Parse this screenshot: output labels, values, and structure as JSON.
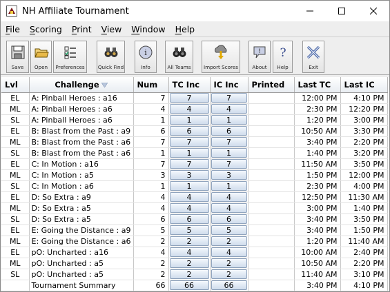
{
  "window": {
    "title": "NH Affiliate Tournament",
    "controls": [
      "minimize-icon",
      "maximize-icon",
      "close-icon"
    ]
  },
  "menu": [
    {
      "label_u": "F",
      "label_rest": "ile"
    },
    {
      "label_u": "S",
      "label_rest": "coring"
    },
    {
      "label_u": "P",
      "label_rest": "rint"
    },
    {
      "label_u": "V",
      "label_rest": "iew"
    },
    {
      "label_u": "W",
      "label_rest": "indow"
    },
    {
      "label_u": "H",
      "label_rest": "elp"
    }
  ],
  "toolbar": {
    "save": "Save",
    "open": "Open",
    "preferences": "Preferences",
    "quick_find": "Quick Find",
    "info": "Info",
    "all_teams": "All Teams",
    "import_scores": "Import Scores",
    "about": "About",
    "help": "Help",
    "exit": "Exit"
  },
  "table": {
    "columns": [
      "Lvl",
      "Challenge",
      "Num",
      "TC Inc",
      "IC Inc",
      "Printed",
      "Last TC",
      "Last IC"
    ],
    "sorted_column": "Challenge",
    "rows": [
      {
        "lvl": "EL",
        "challenge": "A: Pinball Heroes : a16",
        "num": "7",
        "tc_inc": "7",
        "ic_inc": "7",
        "printed": "",
        "last_tc": "12:00 PM",
        "last_ic": "4:10 PM"
      },
      {
        "lvl": "ML",
        "challenge": "A: Pinball Heroes : a6",
        "num": "4",
        "tc_inc": "4",
        "ic_inc": "4",
        "printed": "",
        "last_tc": "2:30 PM",
        "last_ic": "12:20 PM"
      },
      {
        "lvl": "SL",
        "challenge": "A: Pinball Heroes : a6",
        "num": "1",
        "tc_inc": "1",
        "ic_inc": "1",
        "printed": "",
        "last_tc": "1:20 PM",
        "last_ic": "3:00 PM"
      },
      {
        "lvl": "EL",
        "challenge": "B: Blast from the Past : a9",
        "num": "6",
        "tc_inc": "6",
        "ic_inc": "6",
        "printed": "",
        "last_tc": "10:50 AM",
        "last_ic": "3:30 PM"
      },
      {
        "lvl": "ML",
        "challenge": "B: Blast from the Past : a6",
        "num": "7",
        "tc_inc": "7",
        "ic_inc": "7",
        "printed": "",
        "last_tc": "3:40 PM",
        "last_ic": "2:20 PM"
      },
      {
        "lvl": "SL",
        "challenge": "B: Blast from the Past : a6",
        "num": "1",
        "tc_inc": "1",
        "ic_inc": "1",
        "printed": "",
        "last_tc": "1:40 PM",
        "last_ic": "3:20 PM"
      },
      {
        "lvl": "EL",
        "challenge": "C: In Motion : a16",
        "num": "7",
        "tc_inc": "7",
        "ic_inc": "7",
        "printed": "",
        "last_tc": "11:50 AM",
        "last_ic": "3:50 PM"
      },
      {
        "lvl": "ML",
        "challenge": "C: In Motion : a5",
        "num": "3",
        "tc_inc": "3",
        "ic_inc": "3",
        "printed": "",
        "last_tc": "1:50 PM",
        "last_ic": "12:00 PM"
      },
      {
        "lvl": "SL",
        "challenge": "C: In Motion : a6",
        "num": "1",
        "tc_inc": "1",
        "ic_inc": "1",
        "printed": "",
        "last_tc": "2:30 PM",
        "last_ic": "4:00 PM"
      },
      {
        "lvl": "EL",
        "challenge": "D: So Extra : a9",
        "num": "4",
        "tc_inc": "4",
        "ic_inc": "4",
        "printed": "",
        "last_tc": "12:50 PM",
        "last_ic": "11:30 AM"
      },
      {
        "lvl": "ML",
        "challenge": "D: So Extra : a5",
        "num": "4",
        "tc_inc": "4",
        "ic_inc": "4",
        "printed": "",
        "last_tc": "3:00 PM",
        "last_ic": "1:40 PM"
      },
      {
        "lvl": "SL",
        "challenge": "D: So Extra : a5",
        "num": "6",
        "tc_inc": "6",
        "ic_inc": "6",
        "printed": "",
        "last_tc": "3:40 PM",
        "last_ic": "3:50 PM"
      },
      {
        "lvl": "EL",
        "challenge": "E: Going the Distance : a9",
        "num": "5",
        "tc_inc": "5",
        "ic_inc": "5",
        "printed": "",
        "last_tc": "3:40 PM",
        "last_ic": "1:50 PM"
      },
      {
        "lvl": "ML",
        "challenge": "E: Going the Distance : a6",
        "num": "2",
        "tc_inc": "2",
        "ic_inc": "2",
        "printed": "",
        "last_tc": "1:20 PM",
        "last_ic": "11:40 AM"
      },
      {
        "lvl": "EL",
        "challenge": "pO: Uncharted : a16",
        "num": "4",
        "tc_inc": "4",
        "ic_inc": "4",
        "printed": "",
        "last_tc": "10:00 AM",
        "last_ic": "2:40 PM"
      },
      {
        "lvl": "ML",
        "challenge": "pO: Uncharted : a5",
        "num": "2",
        "tc_inc": "2",
        "ic_inc": "2",
        "printed": "",
        "last_tc": "10:50 AM",
        "last_ic": "2:20 PM"
      },
      {
        "lvl": "SL",
        "challenge": "pO: Uncharted : a5",
        "num": "2",
        "tc_inc": "2",
        "ic_inc": "2",
        "printed": "",
        "last_tc": "11:40 AM",
        "last_ic": "3:10 PM"
      }
    ],
    "summary": {
      "lvl": "",
      "challenge": "Tournament Summary",
      "num": "66",
      "tc_inc": "66",
      "ic_inc": "66",
      "printed": "",
      "last_tc": "3:40 PM",
      "last_ic": "4:10 PM"
    }
  }
}
